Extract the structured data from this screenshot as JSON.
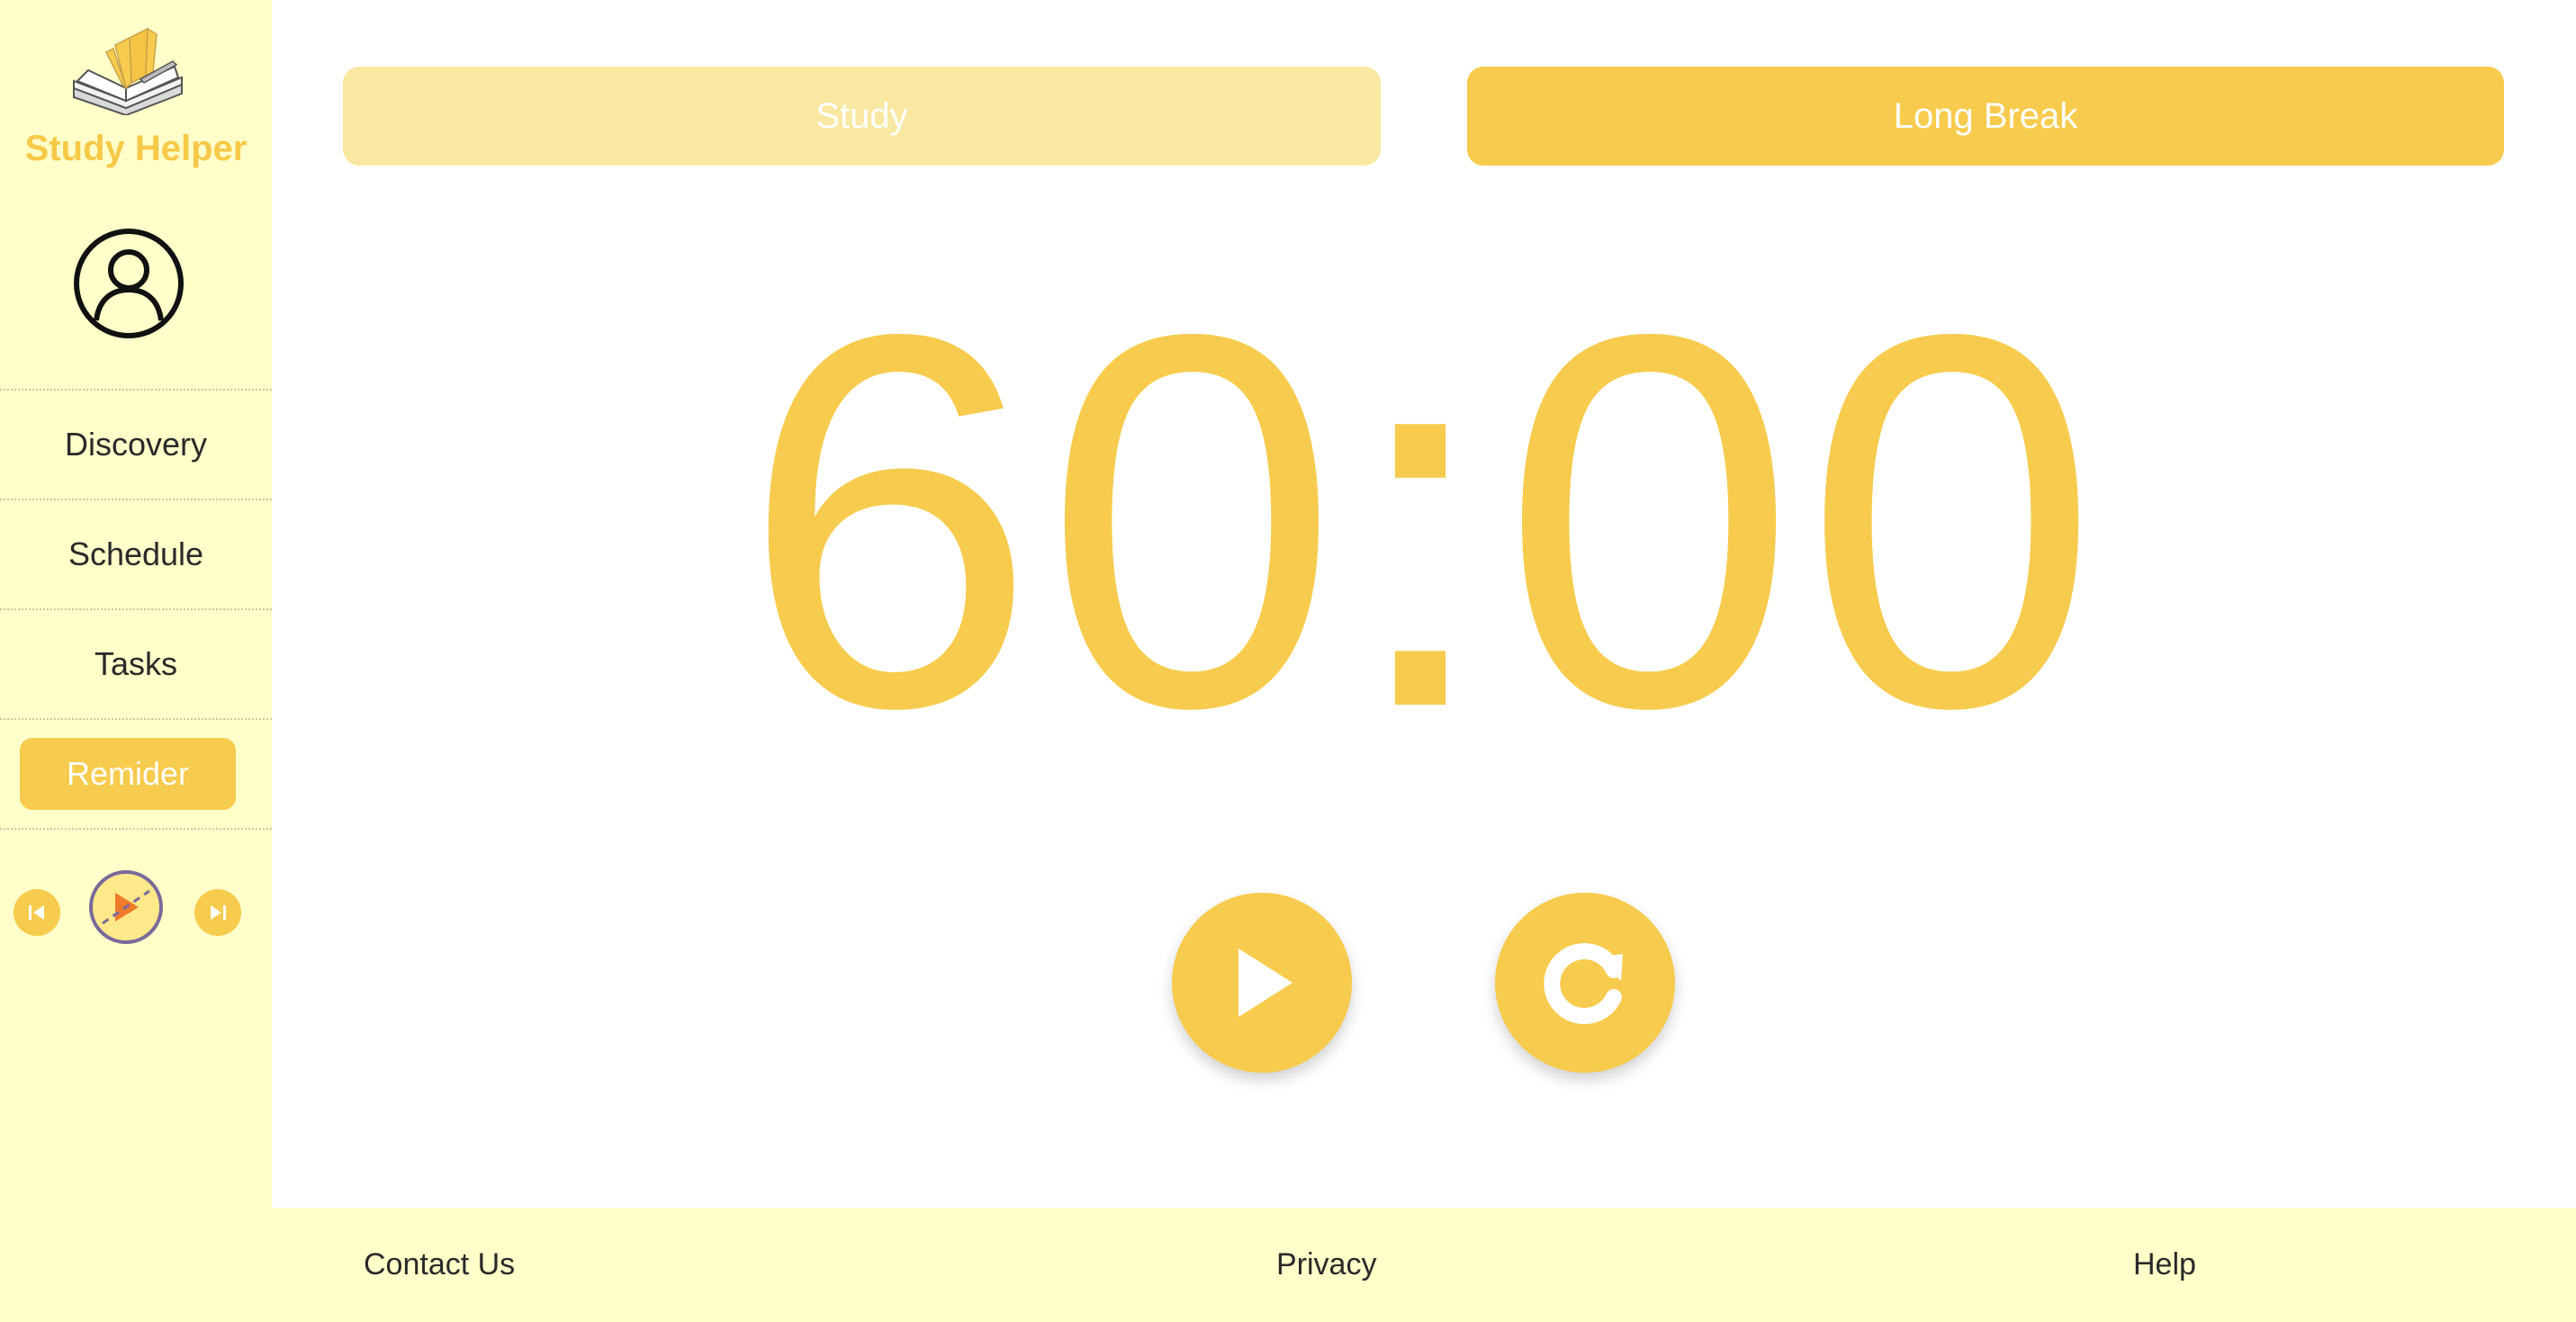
{
  "sidebar": {
    "brand": "Study Helper",
    "nav": [
      {
        "label": "Discovery"
      },
      {
        "label": "Schedule"
      },
      {
        "label": "Tasks"
      }
    ],
    "reminder_label": "Remider"
  },
  "modes": {
    "study_label": "Study",
    "long_break_label": "Long Break",
    "active": "Long Break"
  },
  "timer": {
    "display": "60:00"
  },
  "footer": {
    "contact": "Contact Us",
    "privacy": "Privacy",
    "help": "Help"
  },
  "icons": {
    "logo": "book-icon",
    "profile": "user-circle-icon",
    "prev": "skip-back-icon",
    "disc": "music-disc-icon",
    "next": "skip-forward-icon",
    "play": "play-icon",
    "reset": "reset-icon"
  },
  "colors": {
    "accent": "#f7cb4d",
    "accent_light": "#f9e8a2",
    "sidebar_bg": "#ffffc9"
  }
}
